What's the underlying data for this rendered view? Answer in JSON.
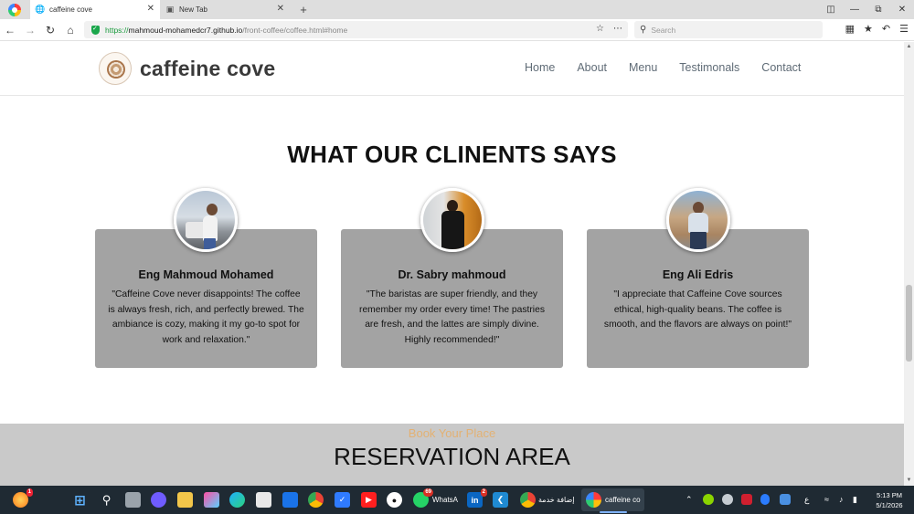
{
  "browser": {
    "tabs": [
      {
        "title": "caffeine cove",
        "active": true
      },
      {
        "title": "New Tab",
        "active": false
      }
    ],
    "new_tab": "+",
    "address": {
      "scheme": "https://",
      "host": "mahmoud-mohamedcr7.github.io",
      "path": "/front-coffee/coffee.html#home"
    },
    "search_placeholder": "Search"
  },
  "site": {
    "brand": "caffeine cove",
    "nav": [
      "Home",
      "About",
      "Menu",
      "Testimonals",
      "Contact"
    ]
  },
  "testimonials": {
    "title": "WHAT OUR CLINENTS SAYS",
    "cards": [
      {
        "name": "Eng Mahmoud Mohamed",
        "quote": "\"Caffeine Cove never disappoints! The coffee is always fresh, rich, and perfectly brewed. The ambiance is cozy, making it my go-to spot for work and relaxation.\""
      },
      {
        "name": "Dr. Sabry mahmoud",
        "quote": "\"The baristas are super friendly, and they remember my order every time! The pastries are fresh, and the lattes are simply divine. Highly recommended!\""
      },
      {
        "name": "Eng Ali Edris",
        "quote": "\"I appreciate that Caffeine Cove sources ethical, high-quality beans. The coffee is smooth, and the flavors are always on point!\""
      }
    ]
  },
  "reservation": {
    "subtitle": "Book Your Place",
    "title": "RESERVATION AREA"
  },
  "taskbar": {
    "whatsapp_label": "WhatsA",
    "whatsapp_badge": "69",
    "linkedin_badge": "2",
    "chrome_label": "إضافة خدمة",
    "active_app_label": "caffeine co",
    "time": "5:13 PM",
    "date": "5/1/2026",
    "lang": "ع"
  }
}
